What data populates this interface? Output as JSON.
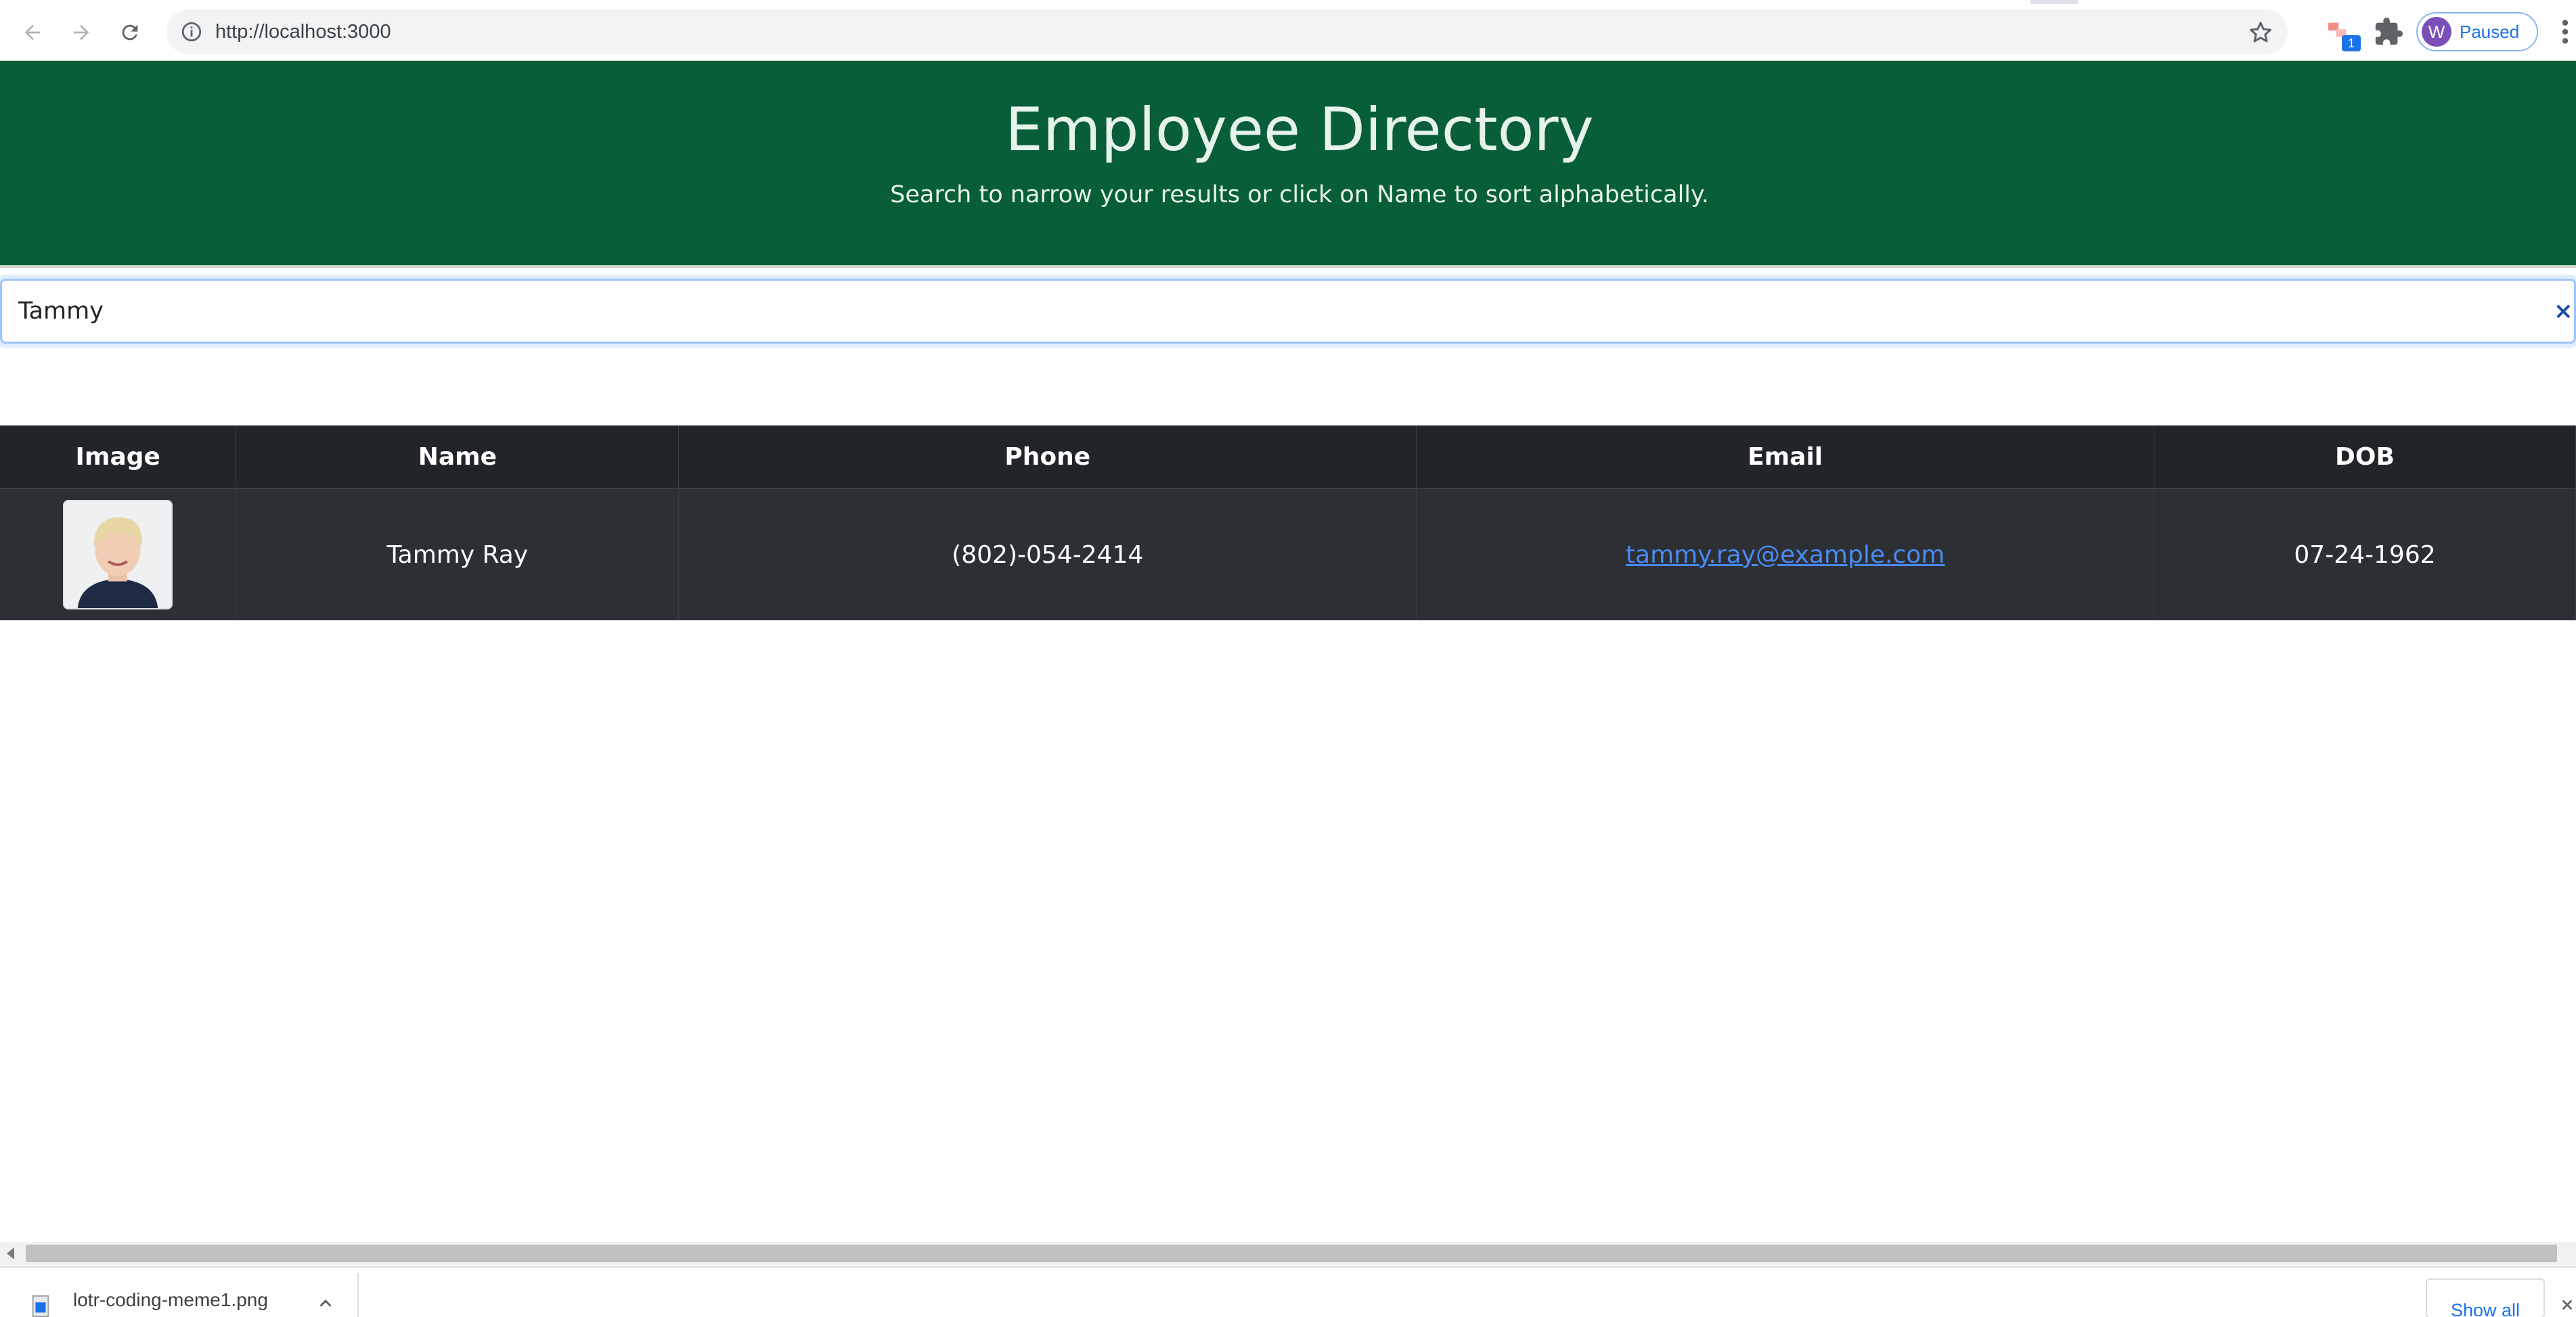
{
  "browser": {
    "url": "http://localhost:3000",
    "extension_badge": "1",
    "profile_initial": "W",
    "profile_status": "Paused"
  },
  "header": {
    "title": "Employee Directory",
    "subtitle": "Search to narrow your results or click on Name to sort alphabetically."
  },
  "search": {
    "value": "Tammy",
    "clear_symbol": "×"
  },
  "table": {
    "columns": [
      "Image",
      "Name",
      "Phone",
      "Email",
      "DOB"
    ],
    "rows": [
      {
        "name": "Tammy Ray",
        "phone": "(802)-054-2414",
        "email": "tammy.ray@example.com",
        "dob": "07-24-1962"
      }
    ]
  },
  "downloads": {
    "file_name": "lotr-coding-meme1.png",
    "show_all_label": "Show all"
  },
  "icons": {
    "back": "arrow-left-icon",
    "forward": "arrow-right-icon",
    "reload": "reload-icon",
    "site_info": "info-icon",
    "bookmark": "star-icon",
    "extensions": "puzzle-icon",
    "menu": "kebab-menu-icon"
  },
  "colors": {
    "header_bg": "#075e37",
    "table_header_bg": "#212529",
    "table_row_bg": "#2c3034",
    "link": "#4a8af4",
    "browser_accent": "#1a73e8"
  }
}
